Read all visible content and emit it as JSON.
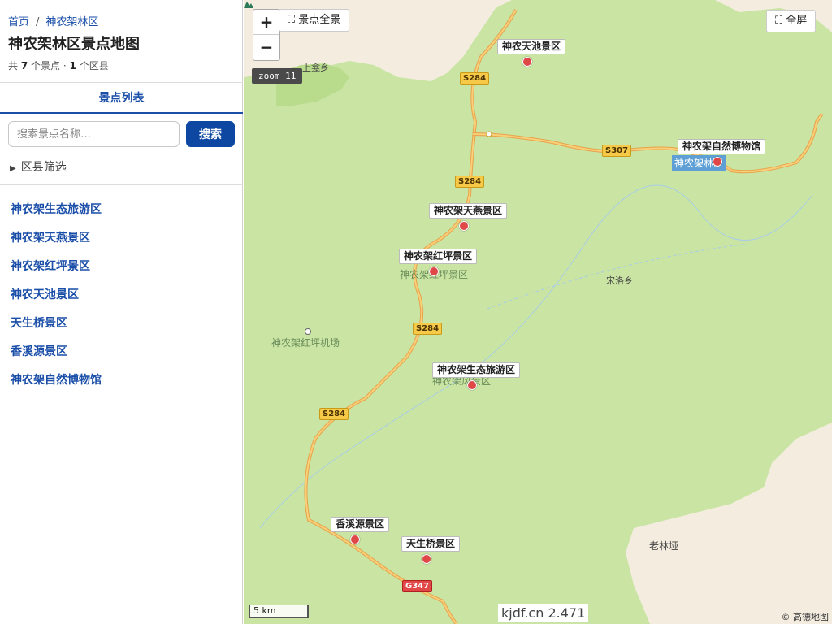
{
  "breadcrumb": {
    "home": "首页",
    "separator": "/",
    "current": "神农架林区"
  },
  "page_title": "神农架林区景点地图",
  "summary": {
    "prefix": "共",
    "spot_count": "7",
    "spot_unit": "个景点 ·",
    "district_count": "1",
    "district_unit": "个区县"
  },
  "tab_label": "景点列表",
  "search": {
    "placeholder": "搜索景点名称…",
    "button": "搜索"
  },
  "filter_label": "区县筛选",
  "spots": [
    "神农架生态旅游区",
    "神农架天燕景区",
    "神农架红坪景区",
    "神农天池景区",
    "天生桥景区",
    "香溪源景区",
    "神农架自然博物馆"
  ],
  "map": {
    "zoom_in": "+",
    "zoom_out": "−",
    "overview_button": "⛶ 景点全景",
    "fullscreen_button": "⛶ 全屏",
    "zoom_badge": "zoom 11",
    "poi_labels": {
      "tianchi": "神农天池景区",
      "museum": "神农架自然博物馆",
      "tianyan": "神农架天燕景区",
      "hongping": "神农架红坪景区",
      "ecotour": "神农架生态旅游区",
      "xiangxi": "香溪源景区",
      "tianshengqiao": "天生桥景区"
    },
    "roads": {
      "r1": "S284",
      "r2": "S307",
      "r3": "S284",
      "r4": "S284",
      "r5": "S284",
      "r6": "G347"
    },
    "place_names": {
      "shangkan": "上龛乡",
      "area_hl": "神农架林区",
      "hongping_area": "神农架红坪景区",
      "songluo": "宋洛乡",
      "airport": "神农架红坪机场",
      "ecotour_area": "神农架风景区",
      "laolinya": "老林垭"
    },
    "scale": "5 km",
    "watermark": "kjdf.cn 2.471",
    "copyright": "© 高德地图",
    "colors": {
      "land": "#c9e4a3",
      "beige": "#f3ecdf",
      "road": "#f6b93b",
      "poi": "#e04848",
      "link": "#1a4ea8",
      "button": "#0d47a1"
    }
  }
}
